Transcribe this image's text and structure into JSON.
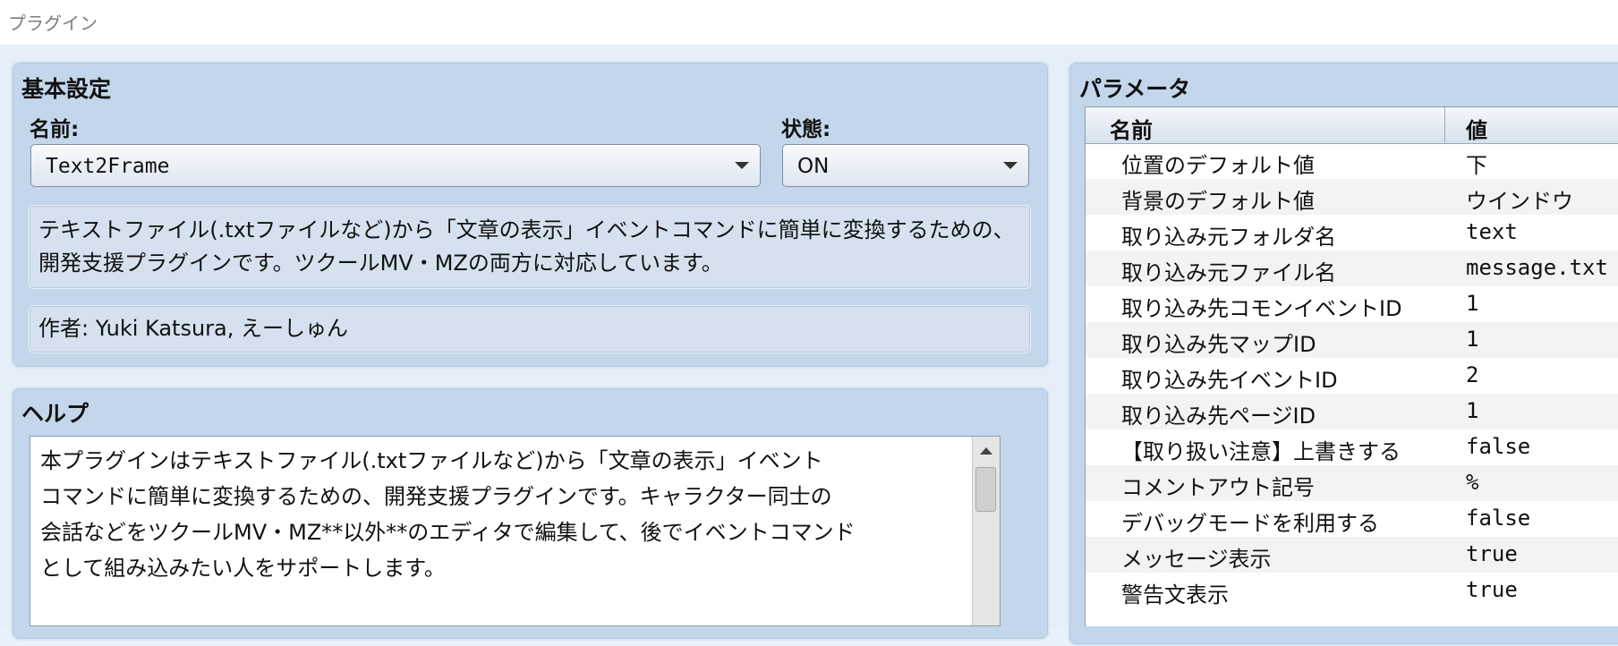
{
  "window": {
    "title": "プラグイン"
  },
  "basic": {
    "heading": "基本設定",
    "name_label": "名前:",
    "name_value": "Text2Frame",
    "status_label": "状態:",
    "status_value": "ON",
    "description": "テキストファイル(.txtファイルなど)から「文章の表示」イベントコマンドに簡単に変換するための、開発支援プラグインです。ツクールMV・MZの両方に対応しています。",
    "author": "作者: Yuki Katsura, えーしゅん"
  },
  "help": {
    "heading": "ヘルプ",
    "text": "本プラグインはテキストファイル(.txtファイルなど)から「文章の表示」イベント\nコマンドに簡単に変換するための、開発支援プラグインです。キャラクター同士の\n会話などをツクールMV・MZ**以外**のエディタで編集して、後でイベントコマンド\nとして組み込みたい人をサポートします。"
  },
  "params": {
    "heading": "パラメータ",
    "col_name": "名前",
    "col_value": "値",
    "rows": [
      {
        "name": "位置のデフォルト値",
        "value": "下"
      },
      {
        "name": "背景のデフォルト値",
        "value": "ウインドウ"
      },
      {
        "name": "取り込み元フォルダ名",
        "value": "text"
      },
      {
        "name": "取り込み元ファイル名",
        "value": "message.txt"
      },
      {
        "name": "取り込み先コモンイベントID",
        "value": "1"
      },
      {
        "name": "取り込み先マップID",
        "value": "1"
      },
      {
        "name": "取り込み先イベントID",
        "value": "2"
      },
      {
        "name": "取り込み先ページID",
        "value": "1"
      },
      {
        "name": "【取り扱い注意】上書きする",
        "value": "false"
      },
      {
        "name": "コメントアウト記号",
        "value": "%"
      },
      {
        "name": "デバッグモードを利用する",
        "value": "false"
      },
      {
        "name": "メッセージ表示",
        "value": "true"
      },
      {
        "name": "警告文表示",
        "value": "true"
      }
    ]
  }
}
